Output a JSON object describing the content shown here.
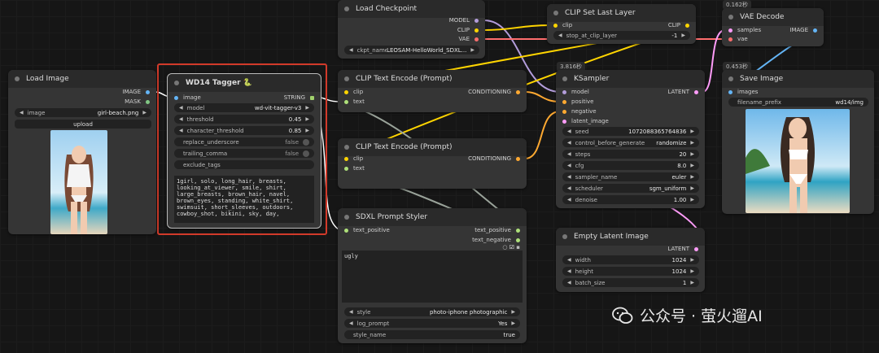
{
  "nodes": {
    "load_image": {
      "title": "Load Image",
      "outputs": [
        "IMAGE",
        "MASK"
      ],
      "image_label": "image",
      "image_value": "girl-beach.png",
      "upload_label": "upload"
    },
    "wd14": {
      "title": "WD14 Tagger 🐍",
      "input": "image",
      "output": "STRING",
      "widgets": [
        {
          "label": "model",
          "value": "wd-vit-tagger-v3"
        },
        {
          "label": "threshold",
          "value": "0.45"
        },
        {
          "label": "character_threshold",
          "value": "0.85"
        },
        {
          "label": "replace_underscore",
          "value": "false"
        },
        {
          "label": "trailing_comma",
          "value": "false"
        },
        {
          "label": "exclude_tags",
          "value": ""
        }
      ],
      "tags_text": "1girl, solo, long_hair, breasts,\nlooking_at_viewer, smile, shirt,\nlarge_breasts, brown_hair, navel,\nbrown_eyes, standing, white_shirt,\nswimsuit, short_sleeves, outdoors,\ncowboy_shot, bikini, sky, day,"
    },
    "load_checkpoint": {
      "title": "Load Checkpoint",
      "outputs": [
        "MODEL",
        "CLIP",
        "VAE"
      ],
      "ckpt_label": "ckpt_name",
      "ckpt_value": "LEOSAM-HelloWorld_SDXL..."
    },
    "clip_last_layer": {
      "title": "CLIP Set Last Layer",
      "input": "clip",
      "output": "CLIP",
      "widget_label": "stop_at_clip_layer",
      "widget_value": "-1"
    },
    "vae_decode": {
      "title": "VAE Decode",
      "timer": "0.162秒",
      "inputs": [
        "samples",
        "vae"
      ],
      "output": "IMAGE"
    },
    "clip_encode_1": {
      "title": "CLIP Text Encode (Prompt)",
      "inputs": [
        "clip",
        "text"
      ],
      "output": "CONDITIONING"
    },
    "clip_encode_2": {
      "title": "CLIP Text Encode (Prompt)",
      "inputs": [
        "clip",
        "text"
      ],
      "output": "CONDITIONING"
    },
    "ksampler": {
      "title": "KSampler",
      "timer": "3.816秒",
      "inputs": [
        "model",
        "positive",
        "negative",
        "latent_image"
      ],
      "output": "LATENT",
      "widgets": [
        {
          "label": "seed",
          "value": "1072088365764836"
        },
        {
          "label": "control_before_generate",
          "value": "randomize"
        },
        {
          "label": "steps",
          "value": "20"
        },
        {
          "label": "cfg",
          "value": "8.0"
        },
        {
          "label": "sampler_name",
          "value": "euler"
        },
        {
          "label": "scheduler",
          "value": "sgm_uniform"
        },
        {
          "label": "denoise",
          "value": "1.00"
        }
      ]
    },
    "save_image": {
      "title": "Save Image",
      "timer": "0.453秒",
      "input": "images",
      "prefix_label": "filename_prefix",
      "prefix_value": "wd14/img"
    },
    "prompt_styler": {
      "title": "SDXL Prompt Styler",
      "input": "text_positive",
      "outputs": [
        "text_positive",
        "text_negative"
      ],
      "neg_text": "ugly",
      "widgets": [
        {
          "label": "style",
          "value": "photo-iphone photographic"
        },
        {
          "label": "log_prompt",
          "value": "Yes"
        },
        {
          "label": "style_name",
          "value": "true"
        }
      ]
    },
    "empty_latent": {
      "title": "Empty Latent Image",
      "output": "LATENT",
      "widgets": [
        {
          "label": "width",
          "value": "1024"
        },
        {
          "label": "height",
          "value": "1024"
        },
        {
          "label": "batch_size",
          "value": "1"
        }
      ]
    }
  },
  "watermark": "公众号 · 萤火遛AI",
  "colors": {
    "highlight": "#d23a2a",
    "image": "#64b5f6",
    "clip": "#ffd500",
    "vae": "#ff6e6e",
    "model": "#b39ddb",
    "conditioning": "#ffa931",
    "latent": "#ff9cf9"
  }
}
